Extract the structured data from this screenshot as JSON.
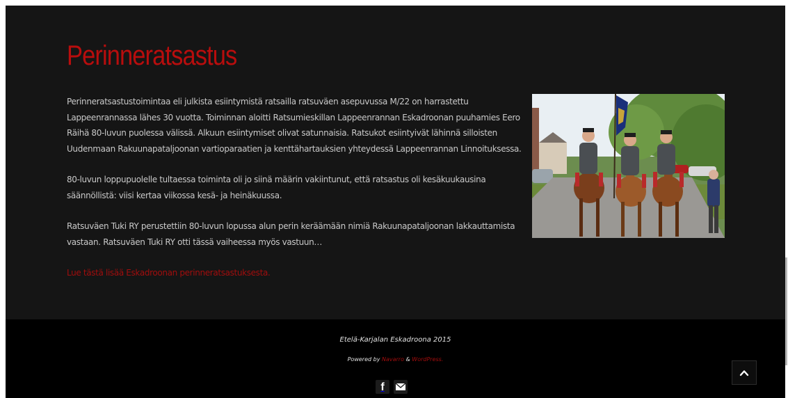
{
  "page": {
    "title": "Perinneratsastus",
    "paragraphs": [
      "Perinneratsastustoimintaa eli julkista esiintymistä ratsailla ratsuväen asepuvussa M/22 on harrastettu Lappeenrannassa lähes 30 vuotta. Toiminnan aloitti Ratsumieskillan Lappeenrannan Eskadroonan puuhamies Eero Räihä 80-luvun puolessa välissä. Alkuun esiintymiset olivat satunnaisia. Ratsukot esiintyivät lähinnä silloisten Uudenmaan Rakuunapataljoonan vartioparaatien ja kenttähartauksien yhteydessä Lappeenrannan Linnoituksessa.",
      "80-luvun loppupuolelle tultaessa toiminta oli jo siinä määrin vakiintunut, että ratsastus oli kesäkuukausina säännöllistä: viisi kertaa viikossa kesä- ja heinäkuussa.",
      "Ratsuväen Tuki RY perustettiin 80-luvun lopussa alun perin keräämään nimiä Rakuunapataljoonan lakkauttamista vastaan. Ratsuväen Tuki RY otti tässä vaiheessa myös vastuun…"
    ],
    "read_more": "Lue tästä lisää Eskadroonan perinneratsastuksesta."
  },
  "footer": {
    "copyright": "Etelä-Karjalan Eskadroona 2015",
    "powered_prefix": "Powered by ",
    "powered_theme": "Navarro",
    "powered_and": " & ",
    "powered_platform": "WordPress."
  },
  "icons": {
    "facebook": "facebook-icon",
    "email": "email-icon",
    "back_to_top": "chevron-up-icon"
  },
  "colors": {
    "accent": "#b80d0d",
    "background": "#151515",
    "footer": "#000000",
    "text": "#c9c9c9"
  }
}
